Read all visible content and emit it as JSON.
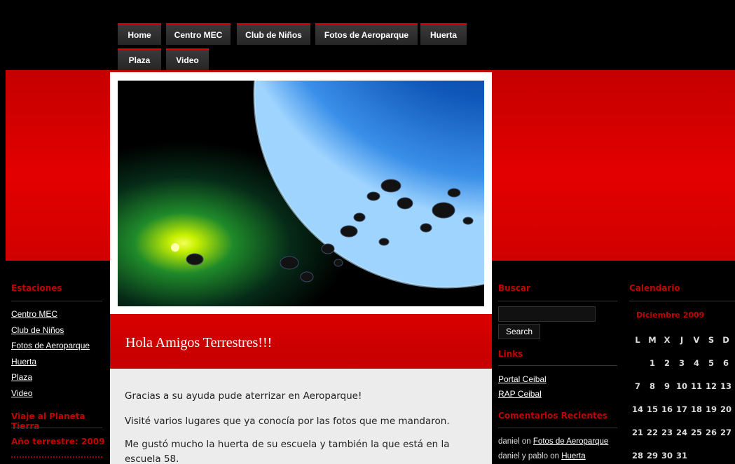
{
  "nav": {
    "row1": [
      "Home",
      "Centro MEC",
      "Club de Niños",
      "Fotos de Aeroparque",
      "Huerta"
    ],
    "row2": [
      "Plaza",
      "Video"
    ]
  },
  "post": {
    "title": "Hola Amigos Terrestres!!!",
    "paragraphs": [
      "Gracias a su ayuda pude aterrizar en Aeroparque!",
      "Visité varios lugares que ya conocía por las fotos que me mandaron.",
      "Me gustó mucho la huerta de su escuela y también la que está en la escuela 58."
    ]
  },
  "left_sidebar": {
    "stations_title": "Estaciones",
    "stations": [
      "Centro MEC",
      "Club de Niños",
      "Fotos de Aeroparque",
      "Huerta",
      "Plaza",
      "Video"
    ],
    "trip_title": "Viaje al Planeta Tierra",
    "year_title": "Año terrestre: 2009"
  },
  "search": {
    "title": "Buscar",
    "input_value": "",
    "button_label": "Search"
  },
  "links": {
    "title": "Links",
    "items": [
      "Portal Ceibal",
      "RAP Ceibal"
    ]
  },
  "comments": {
    "title": "Comentarios Recientes",
    "items": [
      {
        "author": "daniel",
        "on": "on",
        "post": "Fotos de Aeroparque"
      },
      {
        "author": "daniel y pablo",
        "on": "on",
        "post": "Huerta"
      }
    ]
  },
  "calendar": {
    "title": "Calendario",
    "month": "Diciembre 2009",
    "weekdays": [
      "L",
      "M",
      "X",
      "J",
      "V",
      "S",
      "D"
    ],
    "weeks": [
      [
        "",
        "1",
        "2",
        "3",
        "4",
        "5",
        "6"
      ],
      [
        "7",
        "8",
        "9",
        "10",
        "11",
        "12",
        "13"
      ],
      [
        "14",
        "15",
        "16",
        "17",
        "18",
        "19",
        "20"
      ],
      [
        "21",
        "22",
        "23",
        "24",
        "25",
        "26",
        "27"
      ],
      [
        "28",
        "29",
        "30",
        "31",
        "",
        "",
        ""
      ]
    ]
  },
  "colors": {
    "brand_red": "#d00000",
    "background": "#000000",
    "post_body": "#ececec"
  },
  "hero": {
    "icon": "space-planet-image"
  }
}
